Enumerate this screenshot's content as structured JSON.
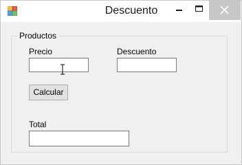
{
  "window": {
    "title": "Descuento"
  },
  "titlebar": {
    "icons": [
      "app-icon",
      "minimize-icon",
      "maximize-icon",
      "close-icon"
    ]
  },
  "group": {
    "title": "Productos"
  },
  "form": {
    "precio_label": "Precio",
    "precio_value": "",
    "descuento_label": "Descuento",
    "descuento_value": "",
    "calcular_label": "Calcular",
    "total_label": "Total",
    "total_value": ""
  },
  "colors": {
    "client_bg": "#f0f0f0",
    "close_hover_bg": "#c7c7c7",
    "textbox_border": "#7a7a7a",
    "button_bg": "#e1e1e1"
  }
}
